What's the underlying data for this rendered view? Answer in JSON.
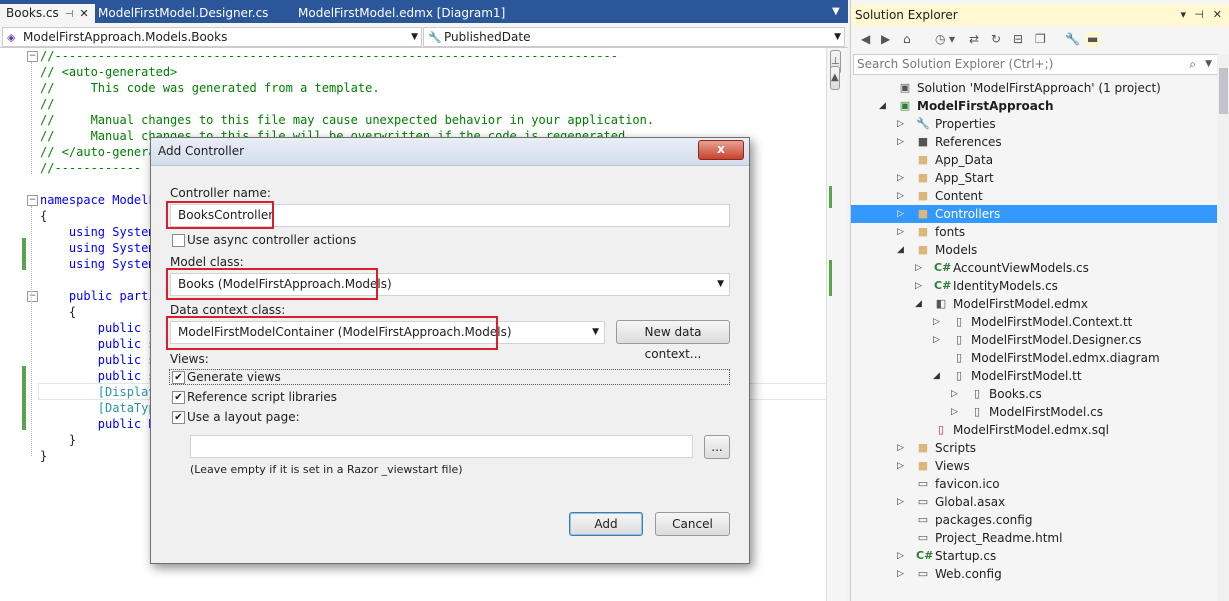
{
  "editor": {
    "tabs": [
      {
        "label": "Books.cs",
        "active": true
      },
      {
        "label": "ModelFirstModel.Designer.cs",
        "active": false
      },
      {
        "label": "ModelFirstModel.edmx [Diagram1]",
        "active": false
      }
    ],
    "nav_left": "ModelFirstApproach.Models.Books",
    "nav_right": "PublishedDate",
    "code_lines": [
      "//------------------------------------------------------------------------------",
      "// <auto-generated>",
      "//     This code was generated from a template.",
      "//",
      "//     Manual changes to this file may cause unexpected behavior in your application.",
      "//     Manual changes to this file will be overwritten if the code is regenerated.",
      "// </auto-genera",
      "//------------",
      "",
      "namespace ModelF",
      "{",
      "    using System",
      "    using System",
      "    using System",
      "",
      "    public parti",
      "    {",
      "        public i",
      "        public s",
      "        public s",
      "        public s",
      "        [Display",
      "        [DataTyp",
      "        public D",
      "    }",
      "}"
    ]
  },
  "solution_explorer": {
    "title": "Solution Explorer",
    "search_placeholder": "Search Solution Explorer (Ctrl+;)",
    "items": [
      {
        "label": "Solution 'ModelFirstApproach' (1 project)",
        "icon": "solution-icon",
        "depth": 0,
        "expander": ""
      },
      {
        "label": "ModelFirstApproach",
        "icon": "csharp-project-icon",
        "depth": 0,
        "expander": "open",
        "bold": true
      },
      {
        "label": "Properties",
        "icon": "wrench-icon",
        "depth": 1,
        "expander": "closed"
      },
      {
        "label": "References",
        "icon": "references-icon",
        "depth": 1,
        "expander": "closed"
      },
      {
        "label": "App_Data",
        "icon": "folder-icon",
        "depth": 1,
        "expander": ""
      },
      {
        "label": "App_Start",
        "icon": "folder-icon",
        "depth": 1,
        "expander": "closed"
      },
      {
        "label": "Content",
        "icon": "folder-icon",
        "depth": 1,
        "expander": "closed"
      },
      {
        "label": "Controllers",
        "icon": "folder-icon",
        "depth": 1,
        "expander": "closed",
        "selected": true
      },
      {
        "label": "fonts",
        "icon": "folder-icon",
        "depth": 1,
        "expander": "closed"
      },
      {
        "label": "Models",
        "icon": "folder-open-icon",
        "depth": 1,
        "expander": "open"
      },
      {
        "label": "AccountViewModels.cs",
        "icon": "csharp-file-icon",
        "depth": 2,
        "expander": "closed"
      },
      {
        "label": "IdentityModels.cs",
        "icon": "csharp-file-icon",
        "depth": 2,
        "expander": "closed"
      },
      {
        "label": "ModelFirstModel.edmx",
        "icon": "edmx-icon",
        "depth": 2,
        "expander": "open"
      },
      {
        "label": "ModelFirstModel.Context.tt",
        "icon": "tt-file-icon",
        "depth": 3,
        "expander": "closed"
      },
      {
        "label": "ModelFirstModel.Designer.cs",
        "icon": "tt-file-icon",
        "depth": 3,
        "expander": "closed"
      },
      {
        "label": "ModelFirstModel.edmx.diagram",
        "icon": "tt-file-icon",
        "depth": 3,
        "expander": ""
      },
      {
        "label": "ModelFirstModel.tt",
        "icon": "tt-file-icon",
        "depth": 3,
        "expander": "open"
      },
      {
        "label": "Books.cs",
        "icon": "tt-file-icon",
        "depth": 4,
        "expander": "closed"
      },
      {
        "label": "ModelFirstModel.cs",
        "icon": "tt-file-icon",
        "depth": 4,
        "expander": "closed"
      },
      {
        "label": "ModelFirstModel.edmx.sql",
        "icon": "sql-file-icon",
        "depth": 2,
        "expander": ""
      },
      {
        "label": "Scripts",
        "icon": "folder-icon",
        "depth": 1,
        "expander": "closed"
      },
      {
        "label": "Views",
        "icon": "folder-icon",
        "depth": 1,
        "expander": "closed"
      },
      {
        "label": "favicon.ico",
        "icon": "image-file-icon",
        "depth": 1,
        "expander": ""
      },
      {
        "label": "Global.asax",
        "icon": "global-asax-icon",
        "depth": 1,
        "expander": "closed"
      },
      {
        "label": "packages.config",
        "icon": "config-file-icon",
        "depth": 1,
        "expander": ""
      },
      {
        "label": "Project_Readme.html",
        "icon": "html-file-icon",
        "depth": 1,
        "expander": ""
      },
      {
        "label": "Startup.cs",
        "icon": "csharp-file-icon",
        "depth": 1,
        "expander": "closed"
      },
      {
        "label": "Web.config",
        "icon": "config-file-icon",
        "depth": 1,
        "expander": "closed"
      }
    ]
  },
  "dialog": {
    "title": "Add Controller",
    "close_label": "x",
    "controller_name_label": "Controller name:",
    "controller_name_value": "BooksController",
    "async_label": "Use async controller actions",
    "async_checked": false,
    "model_class_label": "Model class:",
    "model_class_value": "Books (ModelFirstApproach.Models)",
    "data_context_label": "Data context class:",
    "data_context_value": "ModelFirstModelContainer (ModelFirstApproach.Models)",
    "new_data_context_label": "New data context...",
    "views_label": "Views:",
    "generate_views_label": "Generate views",
    "generate_views_checked": true,
    "reference_scripts_label": "Reference script libraries",
    "reference_scripts_checked": true,
    "layout_page_label": "Use a layout page:",
    "layout_page_checked": true,
    "layout_page_value": "",
    "browse_label": "...",
    "layout_hint": "(Leave empty if it is set in a Razor _viewstart file)",
    "add_label": "Add",
    "cancel_label": "Cancel"
  },
  "colors": {
    "tab_bar": "#2b579a",
    "selection": "#3399ff",
    "highlight_box": "#d6202e",
    "comment": "#008000",
    "keyword": "#0000ff"
  }
}
